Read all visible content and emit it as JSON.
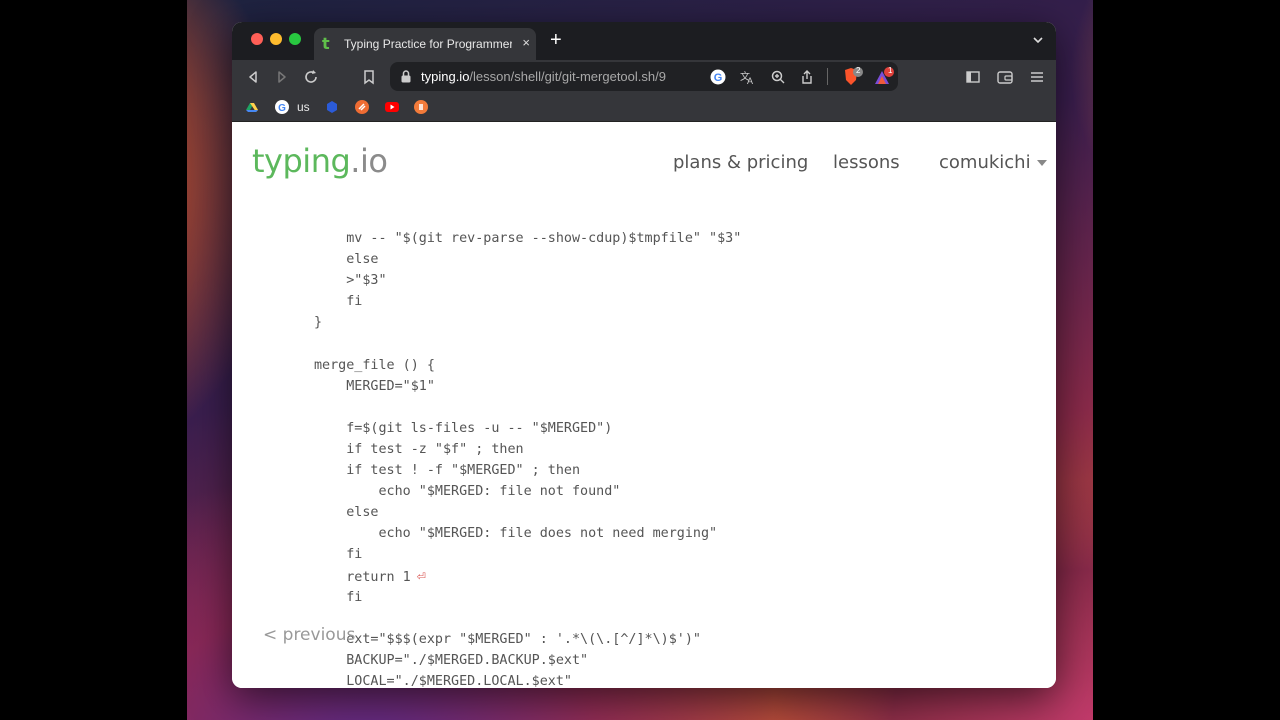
{
  "browser": {
    "tab": {
      "favicon": "t",
      "title": "Typing Practice for Programmers",
      "close": "×"
    },
    "new_tab": "+",
    "url": {
      "host": "typing.io",
      "path": "/lesson/shell/git/git-mergetool.sh/9"
    },
    "bookmarks": [
      {
        "icon": "google-drive-icon",
        "label": ""
      },
      {
        "icon": "google-icon",
        "label": "us"
      },
      {
        "icon": "extension-icon",
        "label": ""
      },
      {
        "icon": "orange-app-icon",
        "label": ""
      },
      {
        "icon": "youtube-icon",
        "label": ""
      },
      {
        "icon": "brave-icon",
        "label": ""
      }
    ],
    "extension_badges": {
      "brave_shields": "2",
      "brave_rewards": "1"
    }
  },
  "site": {
    "logo_main": "typing",
    "logo_tld": ".io",
    "nav": {
      "plans": "plans & pricing",
      "lessons": "lessons",
      "user": "comukichi"
    },
    "previous": "< previous"
  },
  "code_lines": [
    {
      "indent": "    ",
      "text": "mv -- \"$(git rev-parse --show-cdup)$tmpfile\" \"$3\""
    },
    {
      "indent": "    ",
      "text": "else"
    },
    {
      "indent": "    ",
      "text": ">\"$3\""
    },
    {
      "indent": "    ",
      "text": "fi"
    },
    {
      "indent": "",
      "text": "}"
    },
    {
      "indent": "",
      "text": ""
    },
    {
      "indent": "",
      "text": "merge_file () {"
    },
    {
      "indent": "    ",
      "text": "MERGED=\"$1\""
    },
    {
      "indent": "",
      "text": ""
    },
    {
      "indent": "    ",
      "text": "f=$(git ls-files -u -- \"$MERGED\")"
    },
    {
      "indent": "    ",
      "text": "if test -z \"$f\" ; then"
    },
    {
      "indent": "    ",
      "text": "if test ! -f \"$MERGED\" ; then"
    },
    {
      "indent": "        ",
      "text": "echo \"$MERGED: file not found\""
    },
    {
      "indent": "    ",
      "text": "else"
    },
    {
      "indent": "        ",
      "text": "echo \"$MERGED: file does not need merging\""
    },
    {
      "indent": "    ",
      "text": "fi"
    },
    {
      "indent": "    ",
      "text": "return 1",
      "enter": "⏎"
    },
    {
      "indent": "    ",
      "text": "fi"
    },
    {
      "indent": "",
      "text": ""
    },
    {
      "indent": "    ",
      "text": "ext=\"$$$(expr \"$MERGED\" : '.*\\(\\.[^/]*\\)$')\""
    },
    {
      "indent": "    ",
      "text": "BACKUP=\"./$MERGED.BACKUP.$ext\""
    },
    {
      "indent": "    ",
      "text": "LOCAL=\"./$MERGED.LOCAL.$ext\""
    }
  ],
  "colors": {
    "brand_green": "#5cb85c",
    "typed_orange": "#e89a2c",
    "error_red": "#c0392b"
  }
}
